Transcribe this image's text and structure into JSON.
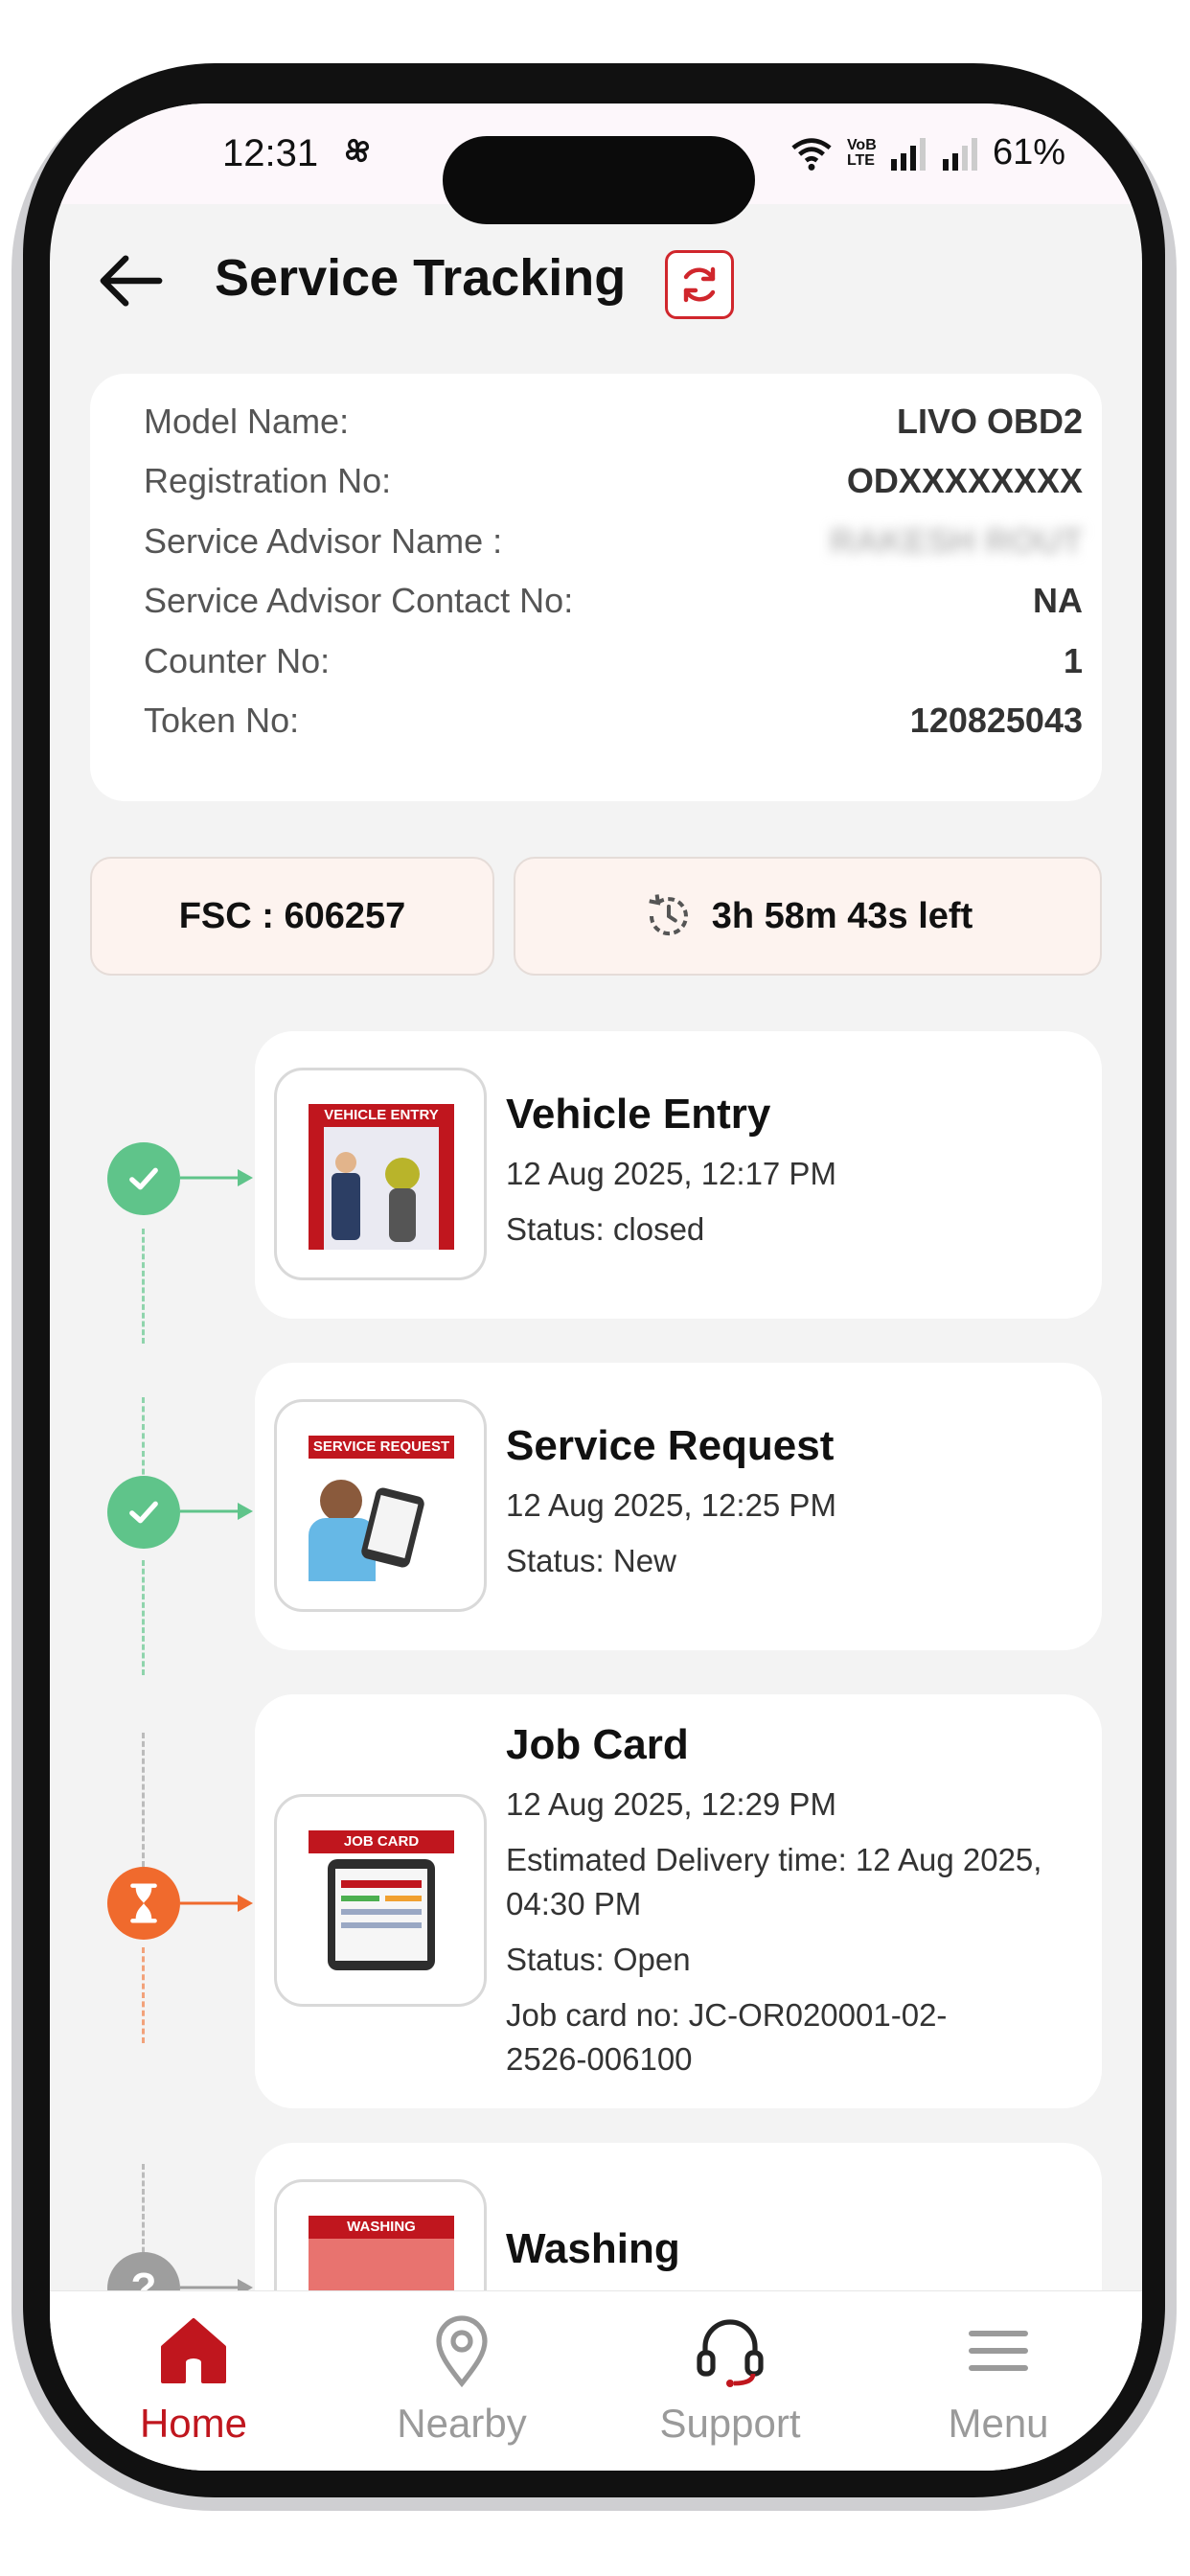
{
  "status_bar": {
    "time": "12:31",
    "battery": "61%",
    "network_label": "VoB LTE"
  },
  "header": {
    "title": "Service Tracking"
  },
  "vehicle_info": [
    {
      "label": "Model Name:",
      "value": "LIVO OBD2"
    },
    {
      "label": "Registration No:",
      "value": "ODXXXXXXXX"
    },
    {
      "label": "Service Advisor Name :",
      "value": "RAKESH ROUT"
    },
    {
      "label": "Service Advisor Contact No:",
      "value": "NA"
    },
    {
      "label": "Counter No:",
      "value": "1"
    },
    {
      "label": "Token No:",
      "value": "120825043"
    }
  ],
  "fsc": {
    "label": "FSC : 606257"
  },
  "countdown": {
    "label": "3h 58m 43s left"
  },
  "timeline": [
    {
      "title": "Vehicle Entry",
      "thumb_banner": "VEHICLE ENTRY",
      "state": "done",
      "lines": [
        "12 Aug 2025, 12:17 PM",
        "Status: closed"
      ]
    },
    {
      "title": "Service Request",
      "thumb_banner": "SERVICE REQUEST",
      "state": "done",
      "lines": [
        "12 Aug 2025, 12:25 PM",
        "Status: New"
      ]
    },
    {
      "title": "Job Card",
      "thumb_banner": "JOB CARD",
      "state": "in-progress",
      "lines": [
        "12 Aug 2025, 12:29 PM",
        "Estimated Delivery time: 12 Aug 2025, 04:30 PM",
        "Status: Open",
        "Job card no: JC-OR020001-02-2526-006100"
      ]
    },
    {
      "title": "Washing",
      "thumb_banner": "WASHING",
      "state": "pending",
      "lines": []
    }
  ],
  "bottom_nav": [
    {
      "label": "Home",
      "icon": "home-icon",
      "active": true
    },
    {
      "label": "Nearby",
      "icon": "location-pin-icon",
      "active": false
    },
    {
      "label": "Support",
      "icon": "headset-icon",
      "active": false
    },
    {
      "label": "Menu",
      "icon": "hamburger-menu-icon",
      "active": false
    }
  ],
  "colors": {
    "accent": "#c0161e",
    "done": "#5fc48a",
    "in_progress": "#f06a2d",
    "pending": "#9e9e9e"
  }
}
